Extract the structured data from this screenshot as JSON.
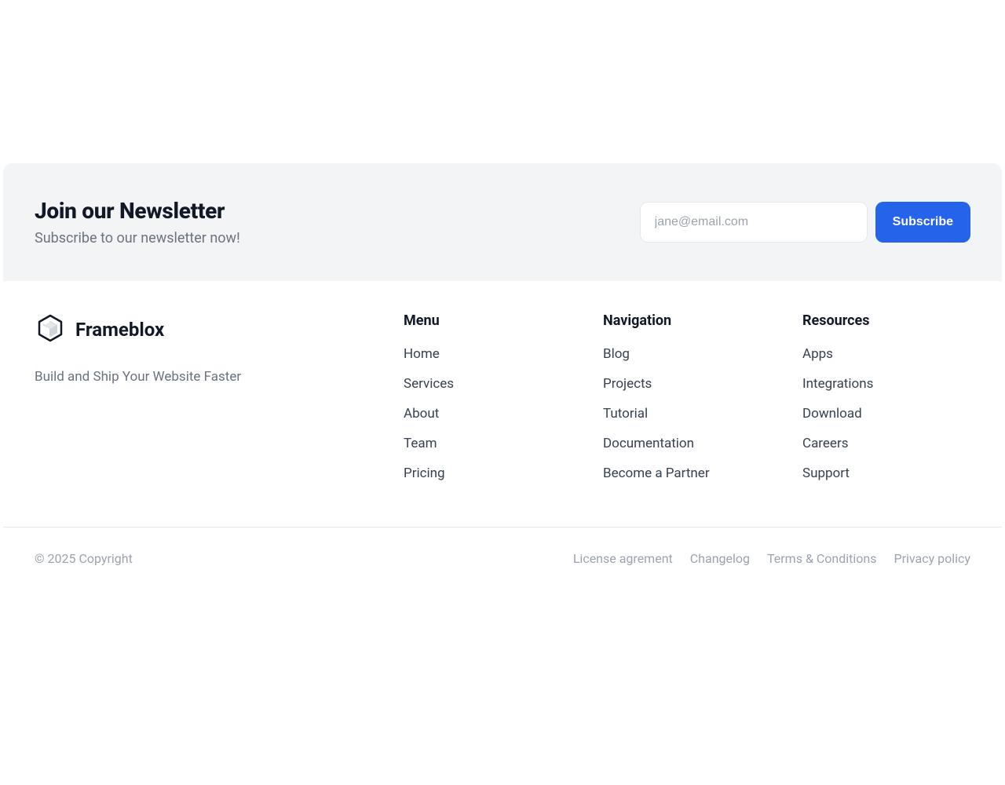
{
  "newsletter": {
    "heading": "Join our Newsletter",
    "sub": "Subscribe to our newsletter now!",
    "email_placeholder": "jane@email.com",
    "subscribe_label": "Subscribe"
  },
  "brand": {
    "name": "Frameblox",
    "tagline": "Build and Ship Your Website Faster"
  },
  "columns": {
    "menu": {
      "title": "Menu",
      "links": [
        "Home",
        "Services",
        "About",
        "Team",
        "Pricing"
      ]
    },
    "navigation": {
      "title": "Navigation",
      "links": [
        "Blog",
        "Projects",
        "Tutorial",
        "Documentation",
        "Become a Partner"
      ]
    },
    "resources": {
      "title": "Resources",
      "links": [
        "Apps",
        "Integrations",
        "Download",
        "Careers",
        "Support"
      ]
    }
  },
  "footer": {
    "copyright": "© 2025 Copyright",
    "legal": [
      "License agrement",
      "Changelog",
      "Terms & Conditions",
      "Privacy policy"
    ]
  }
}
